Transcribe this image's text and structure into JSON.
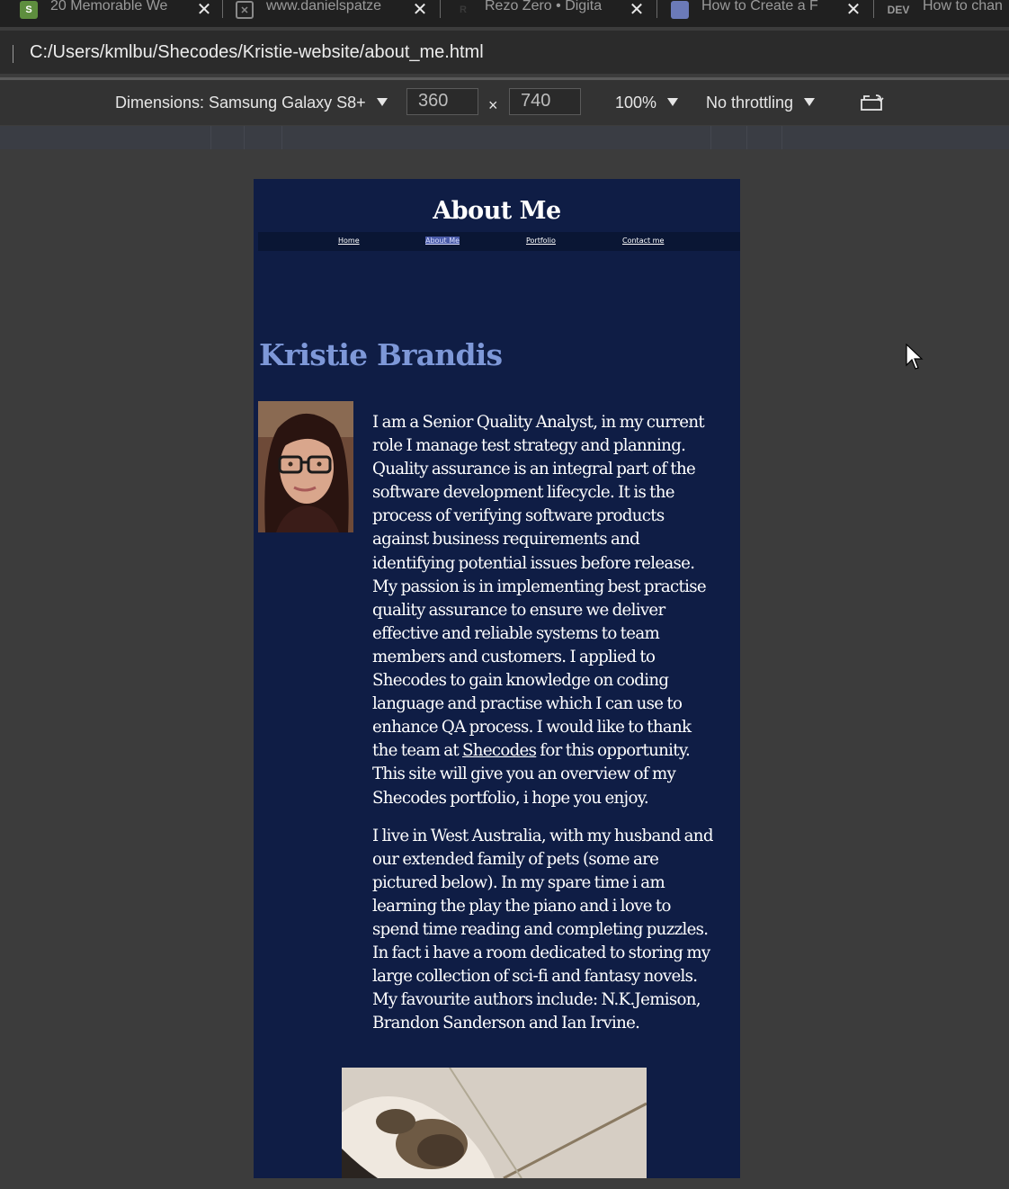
{
  "tabs": [
    {
      "title": "20 Memorable We",
      "icon": "shopify-icon"
    },
    {
      "title": "www.danielspatze",
      "icon": "page-icon"
    },
    {
      "title": "Rezo Zero • Digita",
      "icon": "rezo-icon"
    },
    {
      "title": "How to Create a F",
      "icon": "floppy-icon"
    },
    {
      "title": "How to chan",
      "icon": "dev-icon",
      "icon_text": "DEV"
    }
  ],
  "address": {
    "url": "C:/Users/kmlbu/Shecodes/Kristie-website/about_me.html"
  },
  "devtools": {
    "dimensions_label": "Dimensions: Samsung Galaxy S8+",
    "width": "360",
    "times": "×",
    "height": "740",
    "zoom": "100%",
    "throttling": "No throttling"
  },
  "page": {
    "title": "About Me",
    "nav": [
      "Home",
      "About Me",
      "Portfolio ",
      "Contact me"
    ],
    "name": "Kristie Brandis",
    "para1_before_link": "I am a Senior Quality Analyst, in my current role I manage test strategy and planning. Quality assurance is an integral part of the software development lifecycle. It is the process of verifying software products against business requirements and identifying potential issues before release. My passion is in implementing best practise quality assurance to ensure we deliver effective and reliable systems to team members and customers. I applied to Shecodes to gain knowledge on coding language and practise which I can use to enhance QA process. I would like to thank the team at ",
    "link_text": "Shecodes",
    "para1_after_link": " for this opportunity. This site will give you an overview of my Shecodes portfolio, i hope you enjoy.",
    "para2": "I live in West Australia, with my husband and our extended family of pets (some are pictured below). In my spare time i am learning the play the piano and i love to spend time reading and completing puzzles. In fact i have a room dedicated to storing my large collection of sci-fi and fantasy novels. My favourite authors include: N.K.Jemison, Brandon Sanderson and Ian Irvine."
  },
  "colors": {
    "page_bg": "#0f1d45",
    "nav_bg": "#0a1634",
    "name_heading": "#7e98d8",
    "devtools_bg": "#3c3c3c"
  }
}
